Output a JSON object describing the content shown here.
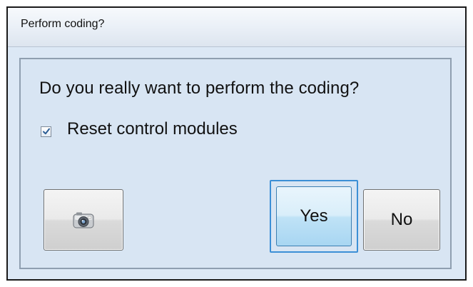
{
  "window": {
    "title": "Perform coding?"
  },
  "dialog": {
    "question": "Do you really want to perform the coding?",
    "checkbox": {
      "label": "Reset control modules",
      "checked": true
    }
  },
  "buttons": {
    "camera": {
      "icon": "camera-icon"
    },
    "yes_label": "Yes",
    "no_label": "No",
    "focused": "yes"
  },
  "colors": {
    "dialog_background": "#d8e5f3",
    "focus_ring": "#3c8fd6",
    "default_button": "#bfe2f6"
  }
}
